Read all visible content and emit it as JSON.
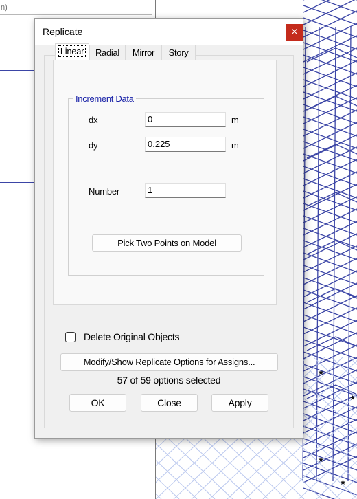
{
  "background": {
    "top_field_text": "n)"
  },
  "dialog": {
    "title": "Replicate",
    "close_glyph": "×",
    "tabs": [
      {
        "label": "Linear",
        "active": true
      },
      {
        "label": "Radial",
        "active": false
      },
      {
        "label": "Mirror",
        "active": false
      },
      {
        "label": "Story",
        "active": false
      }
    ],
    "increment_group": {
      "legend": "Increment Data",
      "dx_label": "dx",
      "dx_value": "0",
      "dx_unit": "m",
      "dy_label": "dy",
      "dy_value": "0.225",
      "dy_unit": "m",
      "number_label": "Number",
      "number_value": "1",
      "pick_button": "Pick Two Points on Model"
    },
    "delete_original_label": "Delete Original Objects",
    "delete_original_checked": false,
    "modify_button": "Modify/Show Replicate Options for Assigns...",
    "options_status": "57 of 59 options selected",
    "ok_button": "OK",
    "close_button": "Close",
    "apply_button": "Apply"
  },
  "colors": {
    "close_red": "#c42b1c",
    "group_legend_blue": "#1a23a8",
    "model_line_blue": "#3b45a6"
  }
}
